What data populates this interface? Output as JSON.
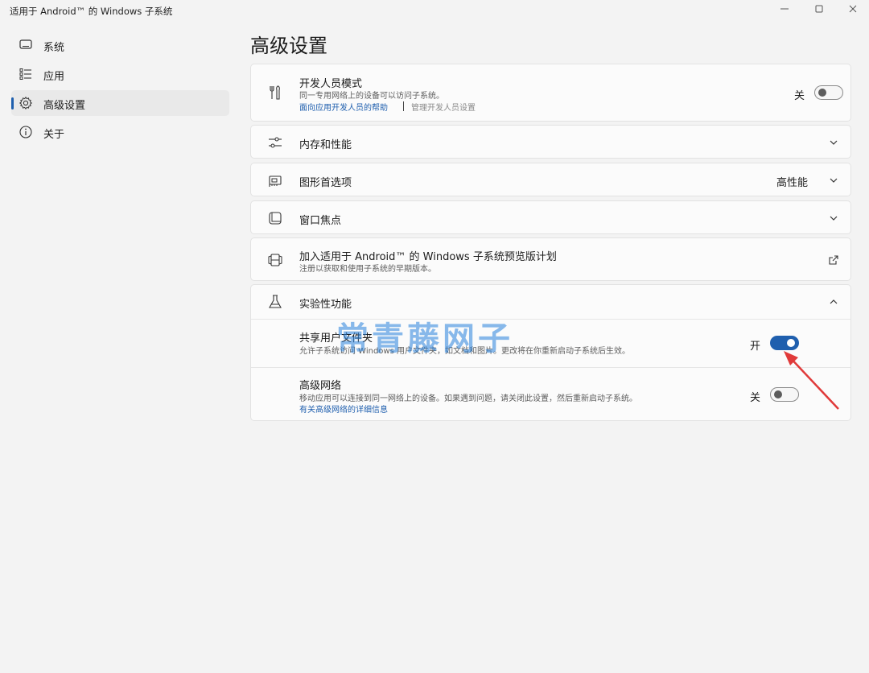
{
  "window": {
    "title": "适用于 Android™ 的 Windows 子系统",
    "minimize": "—",
    "maximize": "☐",
    "close": "✕"
  },
  "nav": {
    "items": [
      {
        "label": "系统",
        "icon": "monitor-icon"
      },
      {
        "label": "应用",
        "icon": "list-icon"
      },
      {
        "label": "高级设置",
        "icon": "gear-icon",
        "selected": true
      },
      {
        "label": "关于",
        "icon": "info-icon"
      }
    ]
  },
  "page": {
    "title": "高级设置"
  },
  "developer_mode": {
    "title": "开发人员模式",
    "description": "同一专用网络上的设备可以访问子系统。",
    "help_link": "面向应用开发人员的帮助",
    "manage_link": "管理开发人员设置",
    "state": "关",
    "on": false
  },
  "memory": {
    "title": "内存和性能"
  },
  "graphics": {
    "title": "图形首选项",
    "value": "高性能"
  },
  "window_focus": {
    "title": "窗口焦点"
  },
  "preview_program": {
    "title": "加入适用于 Android™ 的 Windows 子系统预览版计划",
    "description": "注册以获取和使用子系统的早期版本。"
  },
  "experimental": {
    "title": "实验性功能",
    "share_folder": {
      "title": "共享用户文件夹",
      "description": "允许子系统访问 Windows 用户文件夹，如文档和图片。更改将在你重新启动子系统后生效。",
      "state": "开",
      "on": true
    },
    "advanced_network": {
      "title": "高级网络",
      "description": "移动应用可以连接到同一网络上的设备。如果遇到问题，请关闭此设置，然后重新启动子系统。",
      "link": "有关高级网络的详细信息",
      "state": "关",
      "on": false
    }
  },
  "watermark": "常青藤网子",
  "colors": {
    "accent": "#1f5fae",
    "background": "#f3f3f3",
    "card": "#fbfbfb",
    "annotation_arrow": "#e03a3a"
  }
}
